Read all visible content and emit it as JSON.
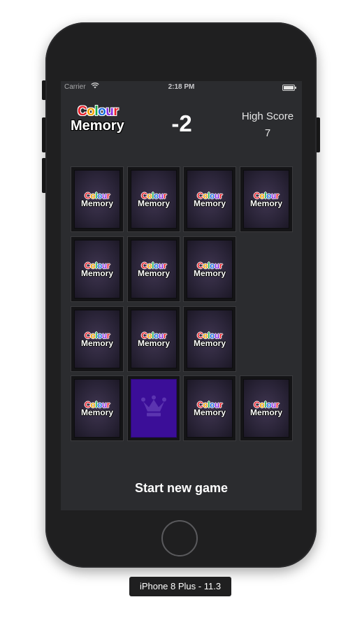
{
  "status_bar": {
    "carrier": "Carrier",
    "time": "2:18 PM"
  },
  "logo": {
    "line1_letters": [
      {
        "char": "C",
        "color": "#e8202a"
      },
      {
        "char": "o",
        "color": "#f4a300"
      },
      {
        "char": "l",
        "color": "#1aa84a"
      },
      {
        "char": "o",
        "color": "#1a6be0"
      },
      {
        "char": "u",
        "color": "#8a2be2"
      },
      {
        "char": "r",
        "color": "#e8202a"
      }
    ],
    "line2": "Memory"
  },
  "score": "-2",
  "high_score": {
    "label": "High Score",
    "value": "7"
  },
  "cards": [
    {
      "state": "hidden"
    },
    {
      "state": "hidden"
    },
    {
      "state": "hidden"
    },
    {
      "state": "hidden"
    },
    {
      "state": "hidden"
    },
    {
      "state": "hidden"
    },
    {
      "state": "hidden"
    },
    {
      "state": "matched"
    },
    {
      "state": "hidden"
    },
    {
      "state": "hidden"
    },
    {
      "state": "hidden"
    },
    {
      "state": "matched"
    },
    {
      "state": "hidden"
    },
    {
      "state": "revealed",
      "icon": "crown-icon",
      "color": "#3b0e98"
    },
    {
      "state": "hidden"
    },
    {
      "state": "hidden"
    }
  ],
  "start_button": "Start new game",
  "device_label": "iPhone 8 Plus - 11.3"
}
